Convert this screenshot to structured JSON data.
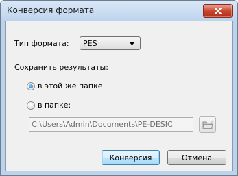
{
  "window": {
    "title": "Конверсия формата"
  },
  "format": {
    "label": "Тип формата:",
    "selected": "PES"
  },
  "save": {
    "label": "Сохранить результаты:",
    "same_folder_label": "в этой же папке",
    "same_folder_checked": true,
    "in_folder_label": "в папке:",
    "in_folder_checked": false,
    "path_value": "C:\\Users\\Admin\\Documents\\PE-DESIC"
  },
  "buttons": {
    "convert": "Конверсия",
    "cancel": "Отмена"
  },
  "icons": {
    "close": "close-icon",
    "dropdown": "chevron-down-icon",
    "browse": "folder-icon"
  },
  "colors": {
    "close_button": "#c8452f",
    "titlebar": "#bfd5ee",
    "accent_radio": "#1a66c8"
  }
}
